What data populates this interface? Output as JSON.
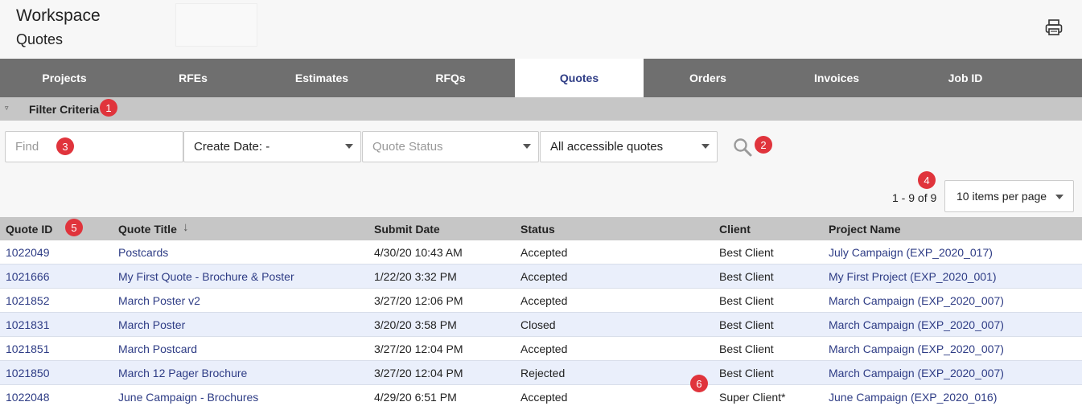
{
  "header": {
    "workspace": "Workspace",
    "subtitle": "Quotes",
    "print_icon": "printer-icon"
  },
  "tabs": [
    {
      "label": "Projects",
      "active": false
    },
    {
      "label": "RFEs",
      "active": false
    },
    {
      "label": "Estimates",
      "active": false
    },
    {
      "label": "RFQs",
      "active": false
    },
    {
      "label": "Quotes",
      "active": true
    },
    {
      "label": "Orders",
      "active": false
    },
    {
      "label": "Invoices",
      "active": false
    },
    {
      "label": "Job ID",
      "active": false
    }
  ],
  "filter": {
    "label": "Filter Criteria",
    "find_placeholder": "Find",
    "find_value": "",
    "create_date": "Create Date: -",
    "quote_status": "Quote Status",
    "scope": "All accessible quotes",
    "search_icon": "search-icon"
  },
  "pager": {
    "range": "1 - 9 of 9",
    "per_page": "10 items per page"
  },
  "annotations": [
    "1",
    "2",
    "3",
    "4",
    "5",
    "6"
  ],
  "columns": {
    "id": "Quote ID",
    "title": "Quote Title",
    "date": "Submit Date",
    "status": "Status",
    "client": "Client",
    "project": "Project Name"
  },
  "rows": [
    {
      "id": "1022049",
      "title": "Postcards",
      "date": "4/30/20 10:43 AM",
      "status": "Accepted",
      "client": "Best Client",
      "project": "July Campaign (EXP_2020_017)"
    },
    {
      "id": "1021666",
      "title": "My First Quote - Brochure & Poster",
      "date": "1/22/20 3:32 PM",
      "status": "Accepted",
      "client": "Best Client",
      "project": "My First Project (EXP_2020_001)"
    },
    {
      "id": "1021852",
      "title": "March Poster v2",
      "date": "3/27/20 12:06 PM",
      "status": "Accepted",
      "client": "Best Client",
      "project": "March Campaign (EXP_2020_007)"
    },
    {
      "id": "1021831",
      "title": "March Poster",
      "date": "3/20/20 3:58 PM",
      "status": "Closed",
      "client": "Best Client",
      "project": "March Campaign (EXP_2020_007)"
    },
    {
      "id": "1021851",
      "title": "March Postcard",
      "date": "3/27/20 12:04 PM",
      "status": "Accepted",
      "client": "Best Client",
      "project": "March Campaign (EXP_2020_007)"
    },
    {
      "id": "1021850",
      "title": "March 12 Pager Brochure",
      "date": "3/27/20 12:04 PM",
      "status": "Rejected",
      "client": "Best Client",
      "project": "March Campaign (EXP_2020_007)"
    },
    {
      "id": "1022048",
      "title": "June Campaign - Brochures",
      "date": "4/29/20 6:51 PM",
      "status": "Accepted",
      "client": "Super Client*",
      "project": "June Campaign (EXP_2020_016)"
    }
  ],
  "colors": {
    "tab_bar": "#6f6f6f",
    "active_tab_text": "#2e3c85",
    "link": "#2e3c85",
    "badge": "#e0343c",
    "row_alt": "#eaeffb"
  }
}
